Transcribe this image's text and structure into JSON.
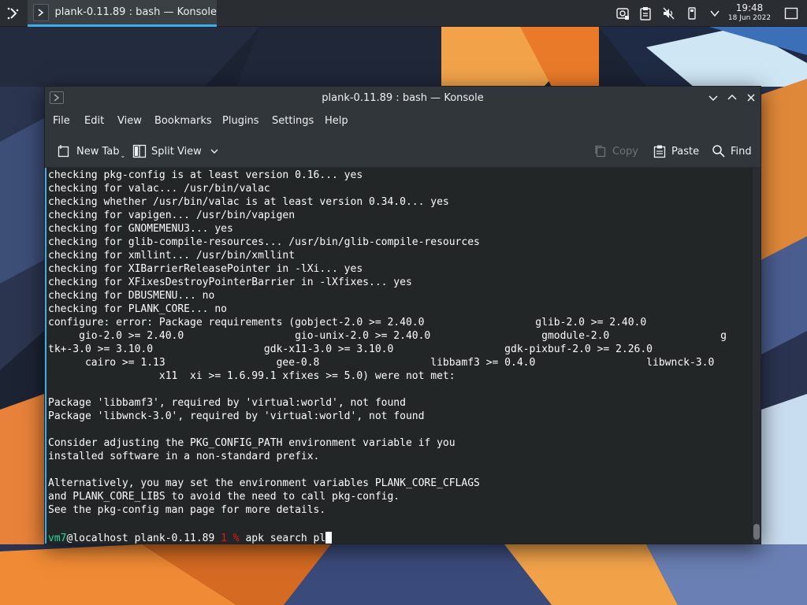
{
  "panel": {
    "task_title": "plank-0.11.89 : bash — Konsole",
    "clock_time": "19:48",
    "clock_date": "18 Jun 2022",
    "icons": [
      "application-launcher-icon",
      "konsole-icon",
      "vault-icon",
      "clipboard-icon",
      "volume-muted-icon",
      "usb-device-icon",
      "chevron-down-icon",
      "show-desktop-icon"
    ]
  },
  "window": {
    "title": "plank-0.11.89 : bash — Konsole",
    "menu": [
      "File",
      "Edit",
      "View",
      "Bookmarks",
      "Plugins",
      "Settings",
      "Help"
    ],
    "toolbar": {
      "new_tab": "New Tab",
      "split_view": "Split View",
      "copy": "Copy",
      "paste": "Paste",
      "find": "Find"
    }
  },
  "terminal": {
    "lines": [
      "checking pkg-config is at least version 0.16... yes",
      "checking for valac... /usr/bin/valac",
      "checking whether /usr/bin/valac is at least version 0.34.0... yes",
      "checking for vapigen... /usr/bin/vapigen",
      "checking for GNOMEMENU3... yes",
      "checking for glib-compile-resources... /usr/bin/glib-compile-resources",
      "checking for xmllint... /usr/bin/xmllint",
      "checking for XIBarrierReleasePointer in -lXi... yes",
      "checking for XFixesDestroyPointerBarrier in -lXfixes... yes",
      "checking for DBUSMENU... no",
      "checking for PLANK_CORE... no",
      "configure: error: Package requirements (gobject-2.0 >= 2.40.0                  glib-2.0 >= 2.40.0",
      "     gio-2.0 >= 2.40.0                  gio-unix-2.0 >= 2.40.0                  gmodule-2.0                  g",
      "tk+-3.0 >= 3.10.0                  gdk-x11-3.0 >= 3.10.0                  gdk-pixbuf-2.0 >= 2.26.0",
      "      cairo >= 1.13                  gee-0.8                  libbamf3 >= 0.4.0                  libwnck-3.0",
      "                  x11  xi >= 1.6.99.1 xfixes >= 5.0) were not met:",
      "",
      "Package 'libbamf3', required by 'virtual:world', not found",
      "Package 'libwnck-3.0', required by 'virtual:world', not found",
      "",
      "Consider adjusting the PKG_CONFIG_PATH environment variable if you",
      "installed software in a non-standard prefix.",
      "",
      "Alternatively, you may set the environment variables PLANK_CORE_CFLAGS",
      "and PLANK_CORE_LIBS to avoid the need to call pkg-config.",
      "See the pkg-config man page for more details."
    ],
    "prompt": {
      "user": "vm7",
      "host_dir": "@localhost plank-0.11.89 ",
      "status": "1 %",
      "command": " apk search pl"
    }
  },
  "colors": {
    "accent": "#3daee9",
    "prompt_user": "#1cdc9a",
    "prompt_status": "#ed1515",
    "terminal_bg": "#232627"
  }
}
